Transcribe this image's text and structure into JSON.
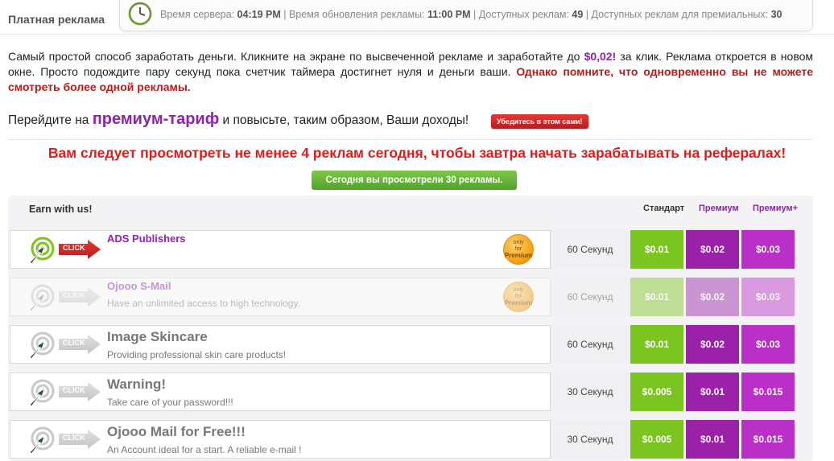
{
  "page_title": "Платная реклама",
  "stats": {
    "server_time_label": "Время сервера:",
    "server_time_value": "04:19 PM",
    "update_time_label": "Время обновления рекламы:",
    "update_time_value": "11:00 PM",
    "available_label": "Доступных реклам:",
    "available_value": "49",
    "premium_available_label": "Доступных реклам для премиальных:",
    "premium_available_value": "30",
    "separator": "|"
  },
  "intro": {
    "text_before_price": "Самый простой способ заработать деньги. Кликните на экране по высвеченной рекламе и заработайте до",
    "price": "$0,02!",
    "text_after_price": "за клик. Реклама откроется в новом окне. Просто подождите пару секунд пока счетчик таймера достигнет нуля и деньги ваши.",
    "warning": "Однако помните, что одновременно вы не можете смотреть более одной рекламы."
  },
  "premium_promo": {
    "before": "Перейдите на",
    "link": "премиум-тариф",
    "after": "и повысьте, таким образом, Ваши доходы!",
    "button": "Убедитесь в этом сами!"
  },
  "notice": "Вам следует просмотреть не менее 4 реклам сегодня, чтобы завтра начать зарабатывать на рефералах!",
  "viewed_today": "Сегодня вы просмотрели 30 рекламы.",
  "ads_table": {
    "title": "Earn with us!",
    "columns": [
      "Стандарт",
      "Премиум",
      "Премиум+"
    ],
    "click_label": "CLICK",
    "badge_lines": [
      "only",
      "for",
      "Premium"
    ],
    "rows": [
      {
        "title": "ADS Publishers",
        "description": "",
        "duration": "60 Секунд",
        "prices": [
          "$0.01",
          "$0.02",
          "$0.03"
        ],
        "premium_only": true,
        "state": "active"
      },
      {
        "title": "Ojooo S-Mail",
        "description": "Have an unlimited access to high technology.",
        "duration": "60 Секунд",
        "prices": [
          "$0.01",
          "$0.02",
          "$0.03"
        ],
        "premium_only": true,
        "state": "faded"
      },
      {
        "title": "Image Skincare",
        "description": "Providing professional skin care products!",
        "duration": "60 Секунд",
        "prices": [
          "$0.01",
          "$0.02",
          "$0.03"
        ],
        "premium_only": false,
        "state": "normal"
      },
      {
        "title": "Warning!",
        "description": "Take care of your password!!!",
        "duration": "30 Секунд",
        "prices": [
          "$0.005",
          "$0.01",
          "$0.015"
        ],
        "premium_only": false,
        "state": "normal"
      },
      {
        "title": "Ojooo Mail for Free!!!",
        "description": "An Account ideal for a start. A reliable e-mail !",
        "duration": "30 Секунд",
        "prices": [
          "$0.005",
          "$0.01",
          "$0.015"
        ],
        "premium_only": false,
        "state": "normal"
      }
    ]
  },
  "colors": {
    "standard": "#7cc520",
    "premium": "#9b22a8",
    "premium_plus": "#ba2fc8",
    "warning_red": "#e01b1b",
    "link_purple": "#8e24aa"
  }
}
